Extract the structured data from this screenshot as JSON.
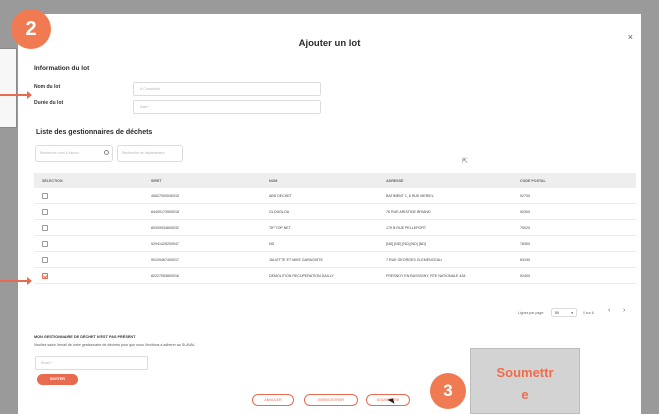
{
  "modal": {
    "title": "Ajouter un lot",
    "close_glyph": "×"
  },
  "lot_info": {
    "section_title": "Information du lot",
    "name_label": "Nom du lot",
    "name_placeholder": "À Consolider",
    "duration_label": "Durée du lot",
    "duration_placeholder": "Date *"
  },
  "list": {
    "title": "Liste des gestionnaires de déchets",
    "search_placeholder": "Recherche nom & raison",
    "filter_placeholder": "Recherche de département"
  },
  "table": {
    "headers": [
      "SÉLECTION",
      "SIRET",
      "NOM",
      "ADRESSE",
      "CODE POSTAL"
    ],
    "rows": [
      {
        "checked": false,
        "siret": "40627000040015",
        "nom": "ABS DECHET",
        "adresse": "BATIMENT 1, 6 RUE MERIEL",
        "cp": "92700"
      },
      {
        "checked": false,
        "siret": "84400173900018",
        "nom": "GLOUGLOU",
        "adresse": "76 RUE ARISTIDE BRIAND",
        "cp": "92300"
      },
      {
        "checked": false,
        "siret": "80309934600032",
        "nom": "TIP TOP NET",
        "adresse": "179 B RUE PELLEPORT",
        "cp": "75020"
      },
      {
        "checked": false,
        "siret": "92941425200047",
        "nom": "ND",
        "adresse": "[ND] [ND] [ND] [ND] [ND]",
        "cp": "78300"
      },
      {
        "checked": false,
        "siret": "90109467400017",
        "nom": "JULIETTE ET MIKE GARAGISTE",
        "adresse": "7 RUE GEORGES CLEMENCEAU",
        "cp": "63190"
      },
      {
        "checked": true,
        "siret": "82227053800016",
        "nom": "DEMOLITION RECUPERATION DAILLY",
        "adresse": "FRESNOY EN BASSIGNY, RTE NATIONALE 428",
        "cp": "52400"
      }
    ]
  },
  "pagination": {
    "per_page_label": "Lignes par page:",
    "per_page_value": "50",
    "range_label": "0 sur 6",
    "prev_glyph": "‹",
    "next_glyph": "›"
  },
  "missing": {
    "title": "MON GESTIONNAIRE DE DÉCHET N'EST PAS PRÉSENT",
    "description": "Veuillez saisir l'email de votre gestionnaire de déchets pour que nous l'invitions à adhérer au Si-AVAL",
    "email_placeholder": "Email *",
    "invite_label": "INVITER"
  },
  "footer": {
    "cancel_label": "ANNULER",
    "save_label": "ENREGISTRER",
    "submit_label": "SOUMETTRE"
  },
  "annotations": {
    "step2": "2",
    "step3": "3",
    "callout_line1": "Soumettr",
    "callout_line2": "e",
    "accent_color": "#f07a52"
  }
}
